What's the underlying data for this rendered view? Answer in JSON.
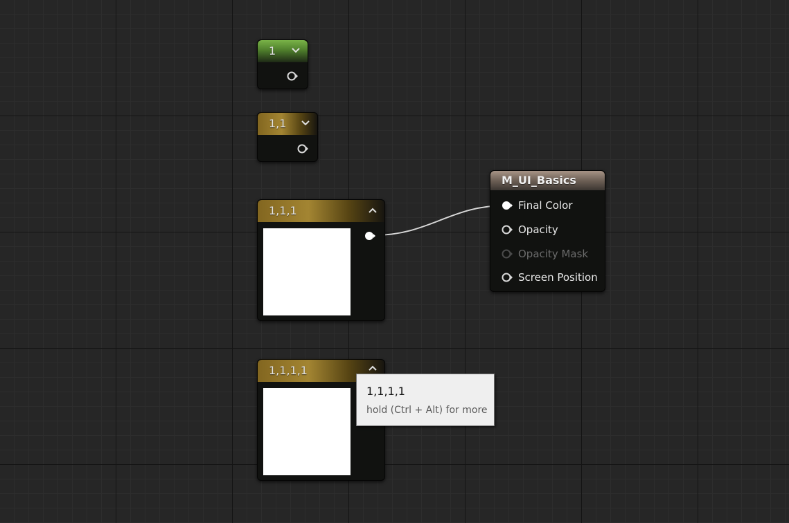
{
  "nodes": {
    "scalar": {
      "value": "1",
      "color": "#5f9438"
    },
    "vec2": {
      "value": "1,1",
      "color": "#957a26"
    },
    "vec3": {
      "value": "1,1,1",
      "color": "#957a26",
      "preview": "#ffffff"
    },
    "vec4": {
      "value": "1,1,1,1",
      "color": "#957a26",
      "preview": "#ffffff"
    }
  },
  "material": {
    "title": "M_UI_Basics",
    "inputs": [
      {
        "label": "Final Color",
        "connected": true,
        "enabled": true
      },
      {
        "label": "Opacity",
        "connected": false,
        "enabled": true
      },
      {
        "label": "Opacity Mask",
        "connected": false,
        "enabled": false
      },
      {
        "label": "Screen Position",
        "connected": false,
        "enabled": true
      }
    ]
  },
  "tooltip": {
    "title": "1,1,1,1",
    "hint": "hold (Ctrl + Alt) for more"
  },
  "icons": {
    "expand": "chevron-down-icon",
    "collapse": "chevron-up-icon",
    "pin": "output-pin-icon"
  }
}
